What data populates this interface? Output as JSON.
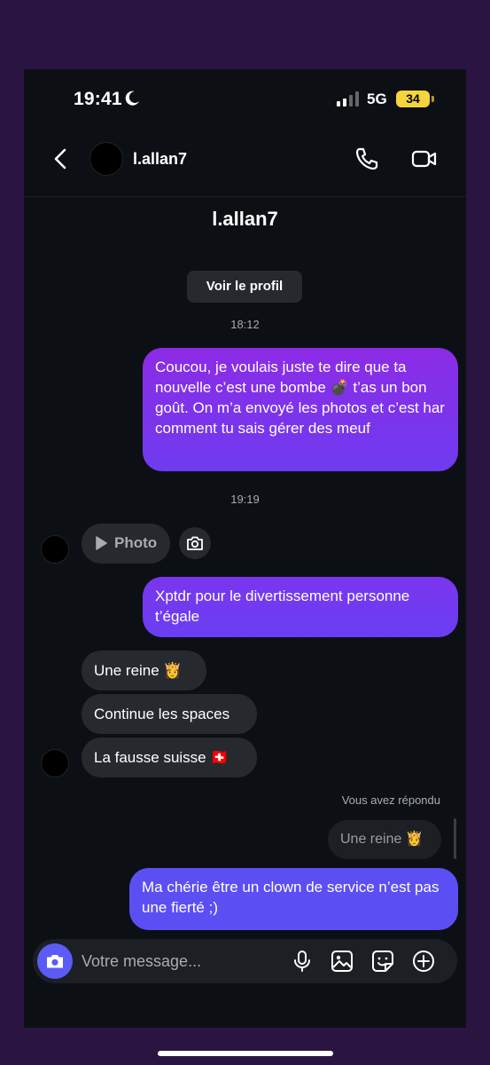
{
  "status": {
    "time": "19:41",
    "network": "5G",
    "battery": "34"
  },
  "header": {
    "username": "l.allan7"
  },
  "profile": {
    "name": "l.allan7",
    "button": "Voir le profil"
  },
  "timestamps": {
    "t1": "18:12",
    "t2": "19:19"
  },
  "messages": {
    "m1": "Coucou, je voulais juste te dire que ta nouvelle c’est une bombe 💣  t’as un bon goût. On m’a envoyé les photos et c’est har comment tu sais gérer des meuf",
    "photo_label": "Photo",
    "m2": "Xptdr pour le divertissement personne t’égale",
    "m3": "Une reine 👸",
    "m4": "Continue les spaces",
    "m5": "La fausse suisse 🇨🇭",
    "replied_label": "Vous avez répondu",
    "reply_quote": "Une reine 👸",
    "m6": "Ma chérie être un clown de service n’est pas une fierté ;)"
  },
  "composer": {
    "placeholder": "Votre message..."
  },
  "colors": {
    "accent": "#5b5cf6",
    "outgoing_top": "#8c2be6",
    "outgoing_bottom": "#6e3bf0",
    "incoming": "#262a2f",
    "background": "#0c1014"
  },
  "icons": [
    "moon-icon",
    "signal-icon",
    "back-icon",
    "phone-icon",
    "video-icon",
    "play-icon",
    "camera-icon",
    "microphone-icon",
    "gallery-icon",
    "sticker-icon",
    "plus-icon"
  ]
}
